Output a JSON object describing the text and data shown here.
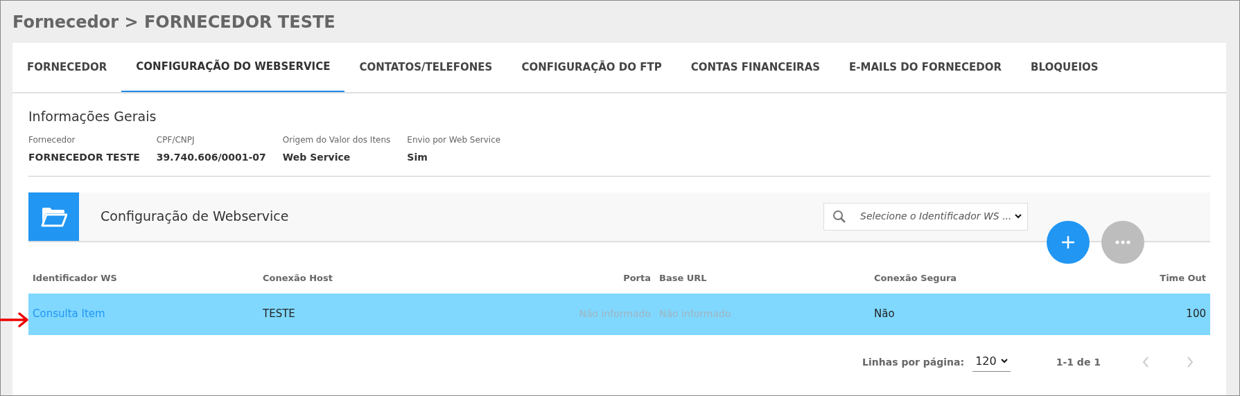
{
  "breadcrumb": "Fornecedor > FORNECEDOR TESTE",
  "tabs": [
    {
      "label": "FORNECEDOR",
      "selected": false
    },
    {
      "label": "CONFIGURAÇÃO DO WEBSERVICE",
      "selected": true
    },
    {
      "label": "CONTATOS/TELEFONES",
      "selected": false
    },
    {
      "label": "CONFIGURAÇÃO DO FTP",
      "selected": false
    },
    {
      "label": "CONTAS FINANCEIRAS",
      "selected": false
    },
    {
      "label": "E-MAILS DO FORNECEDOR",
      "selected": false
    },
    {
      "label": "BLOQUEIOS",
      "selected": false
    }
  ],
  "general_info": {
    "title": "Informações Gerais",
    "fields": [
      {
        "label": "Fornecedor",
        "value": "FORNECEDOR TESTE"
      },
      {
        "label": "CPF/CNPJ",
        "value": "39.740.606/0001-07"
      },
      {
        "label": "Origem do Valor dos Itens",
        "value": "Web Service"
      },
      {
        "label": "Envio por Web Service",
        "value": "Sim"
      }
    ]
  },
  "ws_section": {
    "title": "Configuração de Webservice",
    "search": {
      "placeholder": "Selecione o Identificador WS ..."
    }
  },
  "table": {
    "columns": [
      "Identificador WS",
      "Conexão Host",
      "Porta",
      "Base URL",
      "Conexão Segura",
      "Time Out"
    ],
    "rows": [
      {
        "selected": true,
        "cells": [
          {
            "text": "Consulta Item",
            "kind": "link"
          },
          {
            "text": "TESTE",
            "kind": "text"
          },
          {
            "text": "Não informado",
            "kind": "muted"
          },
          {
            "text": "Não informado",
            "kind": "muted"
          },
          {
            "text": "Não",
            "kind": "text"
          },
          {
            "text": "100",
            "kind": "text"
          }
        ]
      }
    ]
  },
  "pagination": {
    "rows_label": "Linhas por página:",
    "rows_per_page": "120",
    "range": "1-1 de 1"
  }
}
